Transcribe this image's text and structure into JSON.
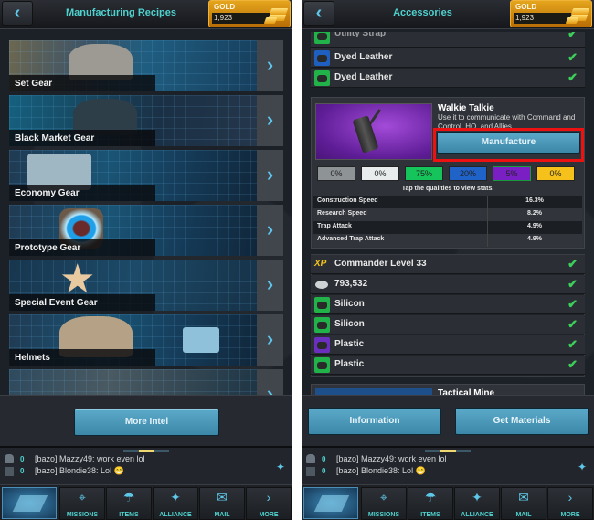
{
  "left_screen": {
    "header": {
      "back_icon": "chevron-left-icon",
      "title": "Manufacturing Recipes",
      "gold": {
        "label": "GOLD",
        "value": "1,923",
        "icon": "gold-bars-icon"
      }
    },
    "recipes": [
      {
        "label": "Set Gear"
      },
      {
        "label": "Black Market Gear"
      },
      {
        "label": "Economy Gear"
      },
      {
        "label": "Prototype Gear"
      },
      {
        "label": "Special Event Gear"
      },
      {
        "label": "Helmets"
      },
      {
        "label": ""
      }
    ],
    "more_intel_label": "More Intel"
  },
  "right_screen": {
    "header": {
      "back_icon": "chevron-left-icon",
      "title": "Accessories",
      "gold": {
        "label": "GOLD",
        "value": "1,923",
        "icon": "gold-bars-icon"
      }
    },
    "top_materials": [
      {
        "label": "Utility Strap",
        "quality_color": "#21b34a",
        "checked": true
      },
      {
        "label": "Dyed Leather",
        "quality_color": "#1e5fbf",
        "checked": true
      },
      {
        "label": "Dyed Leather",
        "quality_color": "#21b34a",
        "checked": true
      }
    ],
    "item": {
      "name": "Walkie Talkie",
      "description": "Use it to communicate with Command and Control, HQ, and Allies.",
      "manufacture_label": "Manufacture",
      "qualities": [
        {
          "value": "0%",
          "color": "#8e9396"
        },
        {
          "value": "0%",
          "color": "#e8ecec"
        },
        {
          "value": "75%",
          "color": "#15c45a"
        },
        {
          "value": "20%",
          "color": "#1f63c9"
        },
        {
          "value": "5%",
          "color": "#7a1fc4"
        },
        {
          "value": "0%",
          "color": "#f5c11a"
        }
      ],
      "qualities_hint": "Tap the qualities to view stats.",
      "stats": [
        {
          "name": "Construction Speed",
          "value": "16.3%"
        },
        {
          "name": "Research Speed",
          "value": "8.2%"
        },
        {
          "name": "Trap Attack",
          "value": "4.9%"
        },
        {
          "name": "Advanced Trap Attack",
          "value": "4.9%"
        }
      ]
    },
    "requirements": [
      {
        "icon": "xp-icon",
        "label": "Commander Level 33",
        "checked": true
      },
      {
        "icon": "silver-coins-icon",
        "label": "793,532",
        "checked": true
      },
      {
        "icon": "silicon-icon",
        "label": "Silicon",
        "quality_color": "#21b34a",
        "checked": true
      },
      {
        "icon": "silicon-icon",
        "label": "Silicon",
        "quality_color": "#21b34a",
        "checked": true
      },
      {
        "icon": "plastic-icon",
        "label": "Plastic",
        "quality_color": "#6b2fbf",
        "checked": true
      },
      {
        "icon": "plastic-icon",
        "label": "Plastic",
        "quality_color": "#21b34a",
        "checked": true
      }
    ],
    "next_item_name": "Tactical Mine",
    "information_label": "Information",
    "get_materials_label": "Get Materials"
  },
  "chat": {
    "player_count": "0",
    "message_count": "0",
    "messages": [
      "[bazo] Mazzy49: work even lol",
      "[bazo] Blondie38: Lol 😁"
    ]
  },
  "nav": {
    "items": [
      {
        "label": "MISSIONS",
        "icon": "crosshair-icon",
        "glyph": "⌖"
      },
      {
        "label": "ITEMS",
        "icon": "parachute-crate-icon",
        "glyph": "☂"
      },
      {
        "label": "ALLIANCE",
        "icon": "eagle-icon",
        "glyph": "✦"
      },
      {
        "label": "MAIL",
        "icon": "envelope-icon",
        "glyph": "✉"
      },
      {
        "label": "MORE",
        "icon": "chevron-right-icon",
        "glyph": "›"
      }
    ]
  },
  "glyphs": {
    "back": "‹",
    "arrow": "›",
    "check": "✔",
    "eagle": "✦",
    "xp": "XP"
  }
}
